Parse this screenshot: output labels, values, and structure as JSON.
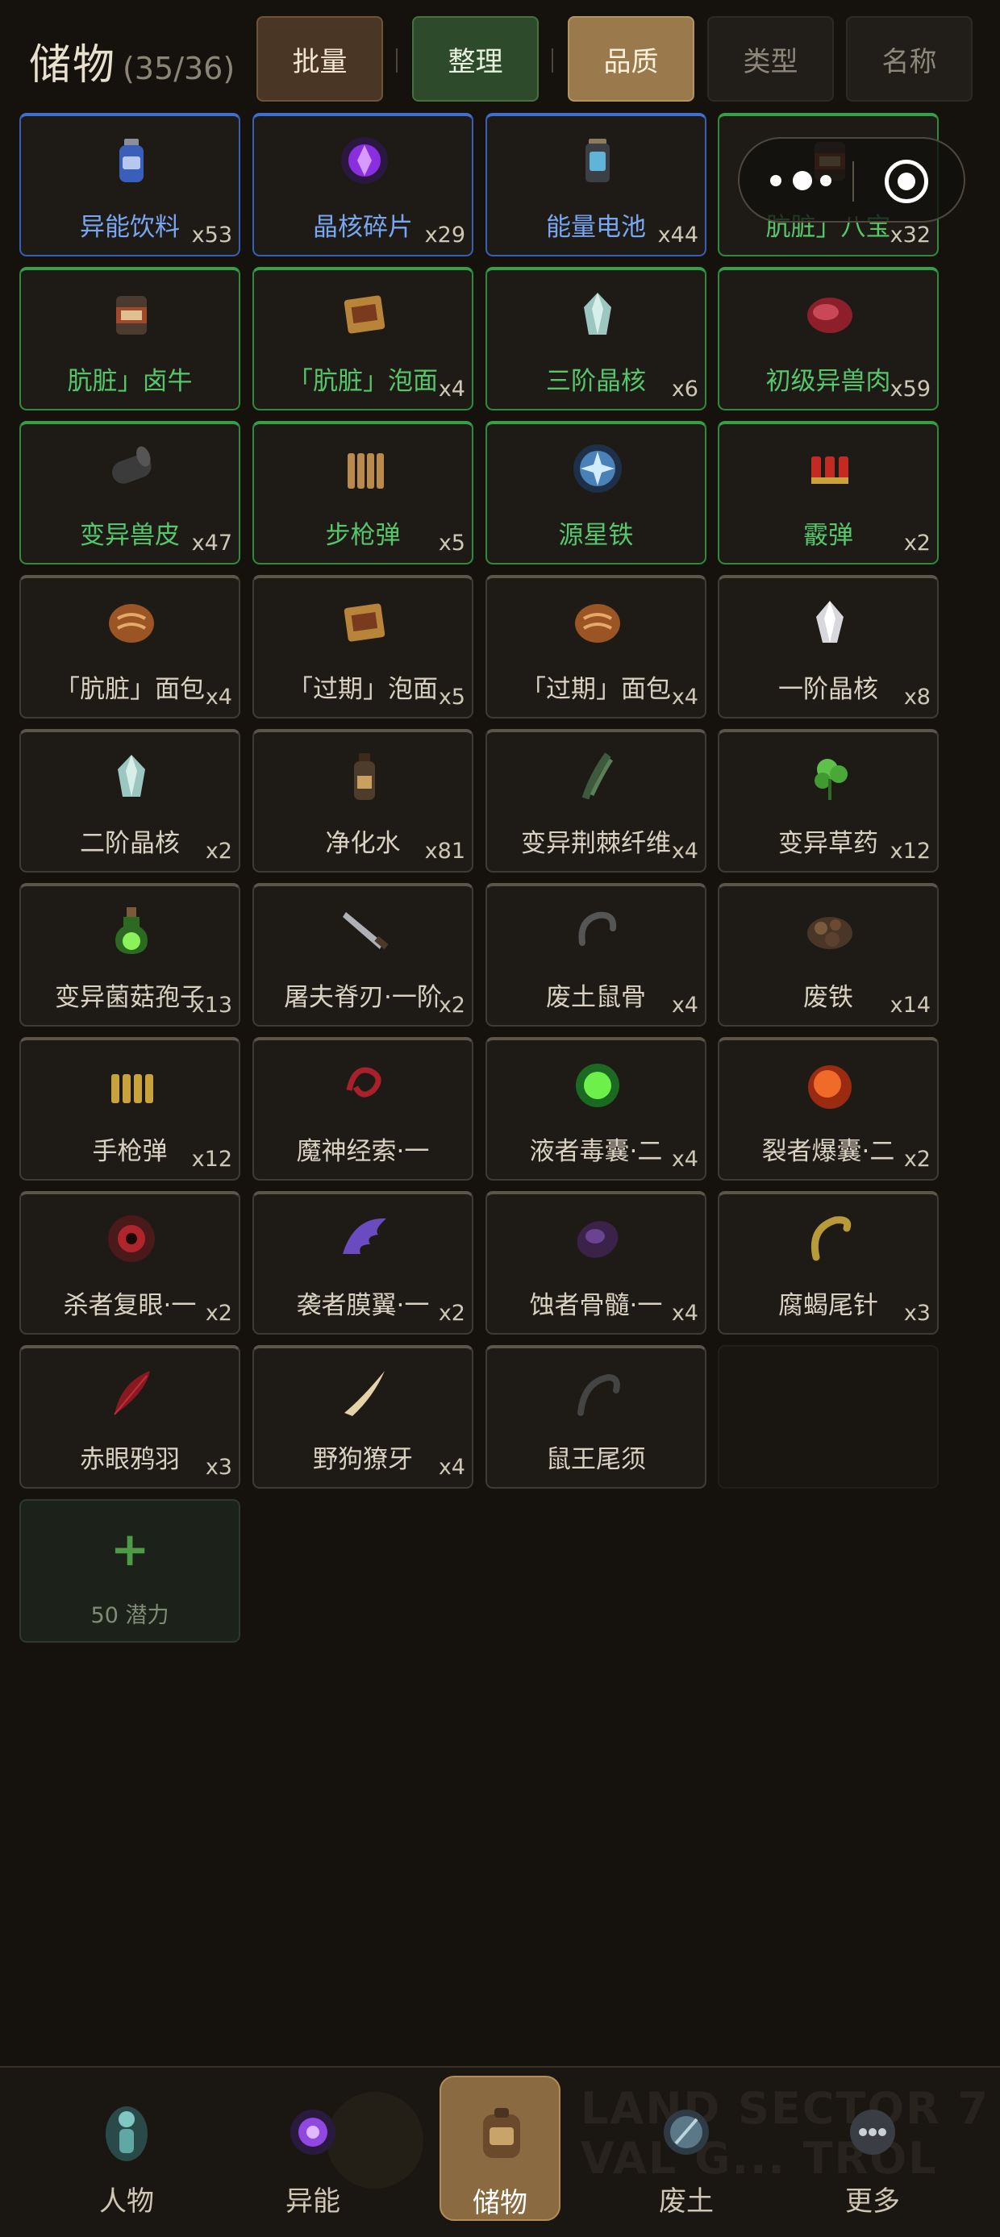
{
  "header": {
    "title": "储物",
    "count": "(35/36)",
    "buttons": {
      "batch": "批量",
      "sort": "整理",
      "quality": "品质",
      "type": "类型",
      "name": "名称"
    }
  },
  "items": [
    {
      "name": "异能饮料",
      "qty": "x53",
      "quality": "blue",
      "icon": "bottle-icon"
    },
    {
      "name": "晶核碎片",
      "qty": "x29",
      "quality": "blue",
      "icon": "purple-crystal-icon"
    },
    {
      "name": "能量电池",
      "qty": "x44",
      "quality": "blue",
      "icon": "battery-icon"
    },
    {
      "name": "肮脏」八宝",
      "qty": "x32",
      "quality": "green",
      "icon": "can-icon"
    },
    {
      "name": "肮脏」卤牛",
      "qty": "",
      "quality": "green",
      "icon": "can-icon"
    },
    {
      "name": "「肮脏」泡面",
      "qty": "x4",
      "quality": "green",
      "icon": "noodle-pack-icon"
    },
    {
      "name": "三阶晶核",
      "qty": "x6",
      "quality": "green",
      "icon": "crystal-icon"
    },
    {
      "name": "初级异兽肉",
      "qty": "x59",
      "quality": "green",
      "icon": "meat-icon"
    },
    {
      "name": "变异兽皮",
      "qty": "x47",
      "quality": "green",
      "icon": "hide-roll-icon"
    },
    {
      "name": "步枪弹",
      "qty": "x5",
      "quality": "green",
      "icon": "rifle-ammo-icon"
    },
    {
      "name": "源星铁",
      "qty": "",
      "quality": "green",
      "icon": "star-iron-icon"
    },
    {
      "name": "霰弹",
      "qty": "x2",
      "quality": "green",
      "icon": "shotgun-shell-icon"
    },
    {
      "name": "「肮脏」面包",
      "qty": "x4",
      "quality": "gray",
      "icon": "bread-icon"
    },
    {
      "name": "「过期」泡面",
      "qty": "x5",
      "quality": "gray",
      "icon": "noodle-pack-icon"
    },
    {
      "name": "「过期」面包",
      "qty": "x4",
      "quality": "gray",
      "icon": "bread-icon"
    },
    {
      "name": "一阶晶核",
      "qty": "x8",
      "quality": "gray",
      "icon": "white-crystal-icon"
    },
    {
      "name": "二阶晶核",
      "qty": "x2",
      "quality": "gray",
      "icon": "crystal-icon"
    },
    {
      "name": "净化水",
      "qty": "x81",
      "quality": "gray",
      "icon": "water-bottle-icon"
    },
    {
      "name": "变异荆棘纤维",
      "qty": "x4",
      "quality": "gray",
      "icon": "thorn-fiber-icon"
    },
    {
      "name": "变异草药",
      "qty": "x12",
      "quality": "gray",
      "icon": "herb-icon"
    },
    {
      "name": "变异菌菇孢子",
      "qty": "x13",
      "quality": "gray",
      "icon": "spore-flask-icon"
    },
    {
      "name": "屠夫脊刃·一阶",
      "qty": "x2",
      "quality": "gray",
      "icon": "blade-icon"
    },
    {
      "name": "废土鼠骨",
      "qty": "x4",
      "quality": "gray",
      "icon": "bone-icon"
    },
    {
      "name": "废铁",
      "qty": "x14",
      "quality": "gray",
      "icon": "scrap-iron-icon"
    },
    {
      "name": "手枪弹",
      "qty": "x12",
      "quality": "gray",
      "icon": "pistol-ammo-icon"
    },
    {
      "name": "魔神经索·一",
      "qty": "",
      "quality": "gray",
      "icon": "nerve-cord-icon"
    },
    {
      "name": "液者毒囊·二",
      "qty": "x4",
      "quality": "gray",
      "icon": "poison-sac-icon"
    },
    {
      "name": "裂者爆囊·二",
      "qty": "x2",
      "quality": "gray",
      "icon": "blast-sac-icon"
    },
    {
      "name": "杀者复眼·一",
      "qty": "x2",
      "quality": "gray",
      "icon": "compound-eye-icon"
    },
    {
      "name": "袭者膜翼·一",
      "qty": "x2",
      "quality": "gray",
      "icon": "wing-icon"
    },
    {
      "name": "蚀者骨髓·一",
      "qty": "x4",
      "quality": "gray",
      "icon": "marrow-icon"
    },
    {
      "name": "腐蝎尾针",
      "qty": "x3",
      "quality": "gray",
      "icon": "stinger-icon"
    },
    {
      "name": "赤眼鸦羽",
      "qty": "x3",
      "quality": "gray",
      "icon": "feather-icon"
    },
    {
      "name": "野狗獠牙",
      "qty": "x4",
      "quality": "gray",
      "icon": "fang-icon"
    },
    {
      "name": "鼠王尾须",
      "qty": "",
      "quality": "gray",
      "icon": "tail-icon"
    }
  ],
  "expand": {
    "plus": "+",
    "label": "50 潜力"
  },
  "nav": [
    {
      "label": "人物",
      "icon": "character-icon",
      "active": false
    },
    {
      "label": "异能",
      "icon": "ability-orb-icon",
      "active": false
    },
    {
      "label": "储物",
      "icon": "backpack-icon",
      "active": true
    },
    {
      "label": "废土",
      "icon": "wasteland-icon",
      "active": false
    },
    {
      "label": "更多",
      "icon": "more-icon",
      "active": false
    }
  ],
  "nav_bg_text": "LAND SECTOR 7 VAL G... TROL",
  "colors": {
    "background": "#15120d",
    "quality_blue": "#3f6fd3",
    "quality_green": "#36a048",
    "quality_gray": "#5c564a",
    "accent_gold": "#9a7a4c"
  }
}
